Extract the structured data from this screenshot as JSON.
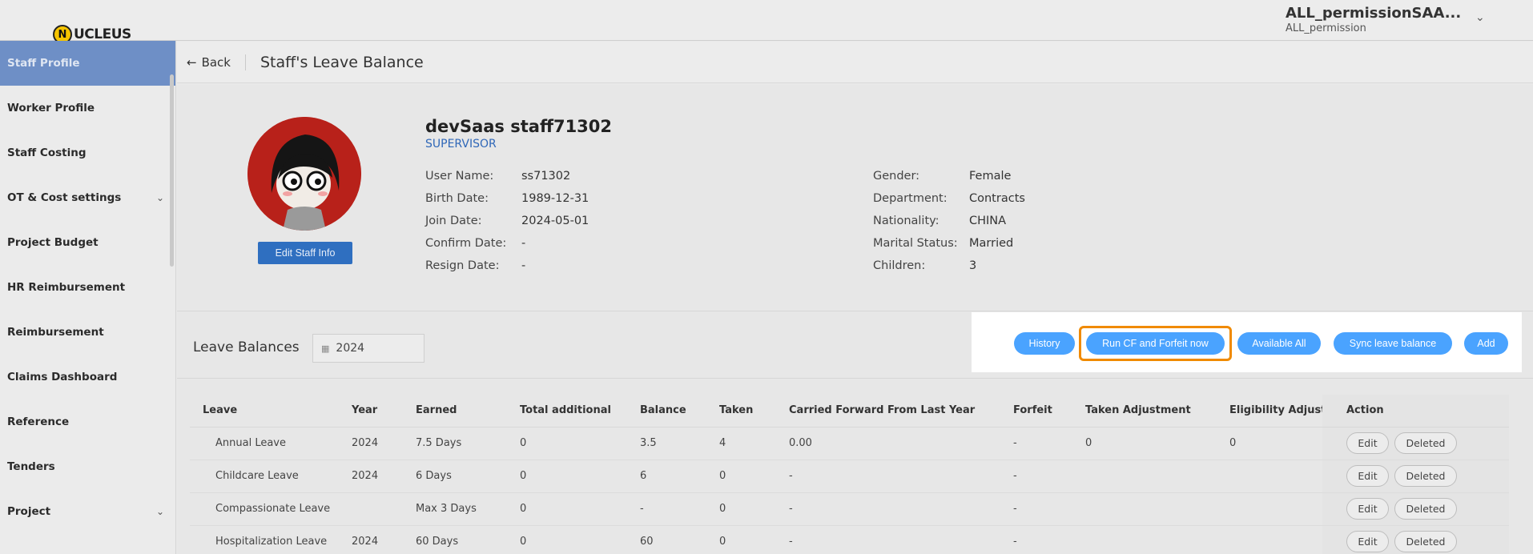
{
  "header": {
    "logo_text": "UCLEUS",
    "logo_letter": "N",
    "user_name": "ALL_permissionSAA...",
    "user_role": "ALL_permission"
  },
  "sidebar": {
    "items": [
      {
        "label": "Staff Profile",
        "active": true
      },
      {
        "label": "Worker Profile"
      },
      {
        "label": "Staff Costing"
      },
      {
        "label": "OT & Cost settings",
        "expandable": true
      },
      {
        "label": "Project Budget"
      },
      {
        "label": "HR Reimbursement"
      },
      {
        "label": "Reimbursement"
      },
      {
        "label": "Claims Dashboard"
      },
      {
        "label": "Reference"
      },
      {
        "label": "Tenders"
      },
      {
        "label": "Project",
        "expandable": true
      }
    ]
  },
  "page": {
    "back_label": "Back",
    "title": "Staff's Leave Balance"
  },
  "profile": {
    "name": "devSaas staff71302",
    "role": "SUPERVISOR",
    "edit_label": "Edit Staff Info",
    "left": [
      {
        "label": "User Name:",
        "value": "ss71302"
      },
      {
        "label": "Birth Date:",
        "value": "1989-12-31"
      },
      {
        "label": "Join Date:",
        "value": "2024-05-01"
      },
      {
        "label": "Confirm Date:",
        "value": "-"
      },
      {
        "label": "Resign Date:",
        "value": "-"
      }
    ],
    "right": [
      {
        "label": "Gender:",
        "value": "Female"
      },
      {
        "label": "Department:",
        "value": "Contracts"
      },
      {
        "label": "Nationality:",
        "value": "CHINA"
      },
      {
        "label": "Marital Status:",
        "value": "Married"
      },
      {
        "label": "Children:",
        "value": "3"
      }
    ]
  },
  "balances": {
    "title": "Leave Balances",
    "year": "2024",
    "buttons": {
      "history": "History",
      "run_cf": "Run CF and Forfeit now",
      "available_all": "Available All",
      "sync": "Sync leave balance",
      "add": "Add"
    },
    "columns": [
      "Leave",
      "Year",
      "Earned",
      "Total additional",
      "Balance",
      "Taken",
      "Carried Forward From Last Year",
      "Forfeit",
      "Taken Adjustment",
      "Eligibility Adjustn",
      "Action"
    ],
    "rows": [
      {
        "leave": "Annual Leave",
        "year": "2024",
        "earned": "7.5 Days",
        "total_additional": "0",
        "balance": "3.5",
        "taken": "4",
        "carried": "0.00",
        "forfeit": "-",
        "taken_adj": "0",
        "elig_adj": "0"
      },
      {
        "leave": "Childcare Leave",
        "year": "2024",
        "earned": "6 Days",
        "total_additional": "0",
        "balance": "6",
        "taken": "0",
        "carried": "-",
        "forfeit": "-",
        "taken_adj": "",
        "elig_adj": ""
      },
      {
        "leave": "Compassionate Leave",
        "year": "",
        "earned": "Max 3 Days",
        "total_additional": "0",
        "balance": "-",
        "taken": "0",
        "carried": "-",
        "forfeit": "-",
        "taken_adj": "",
        "elig_adj": ""
      },
      {
        "leave": "Hospitalization Leave",
        "year": "2024",
        "earned": "60 Days",
        "total_additional": "0",
        "balance": "60",
        "taken": "0",
        "carried": "-",
        "forfeit": "-",
        "taken_adj": "",
        "elig_adj": ""
      }
    ],
    "edit_label": "Edit",
    "delete_label": "Deleted"
  },
  "colors": {
    "active_sidebar": "#6e8fc6",
    "pill_blue": "#4aa3ff",
    "highlight": "#f08a00",
    "edit_staff_blue": "#2f6fc0"
  }
}
